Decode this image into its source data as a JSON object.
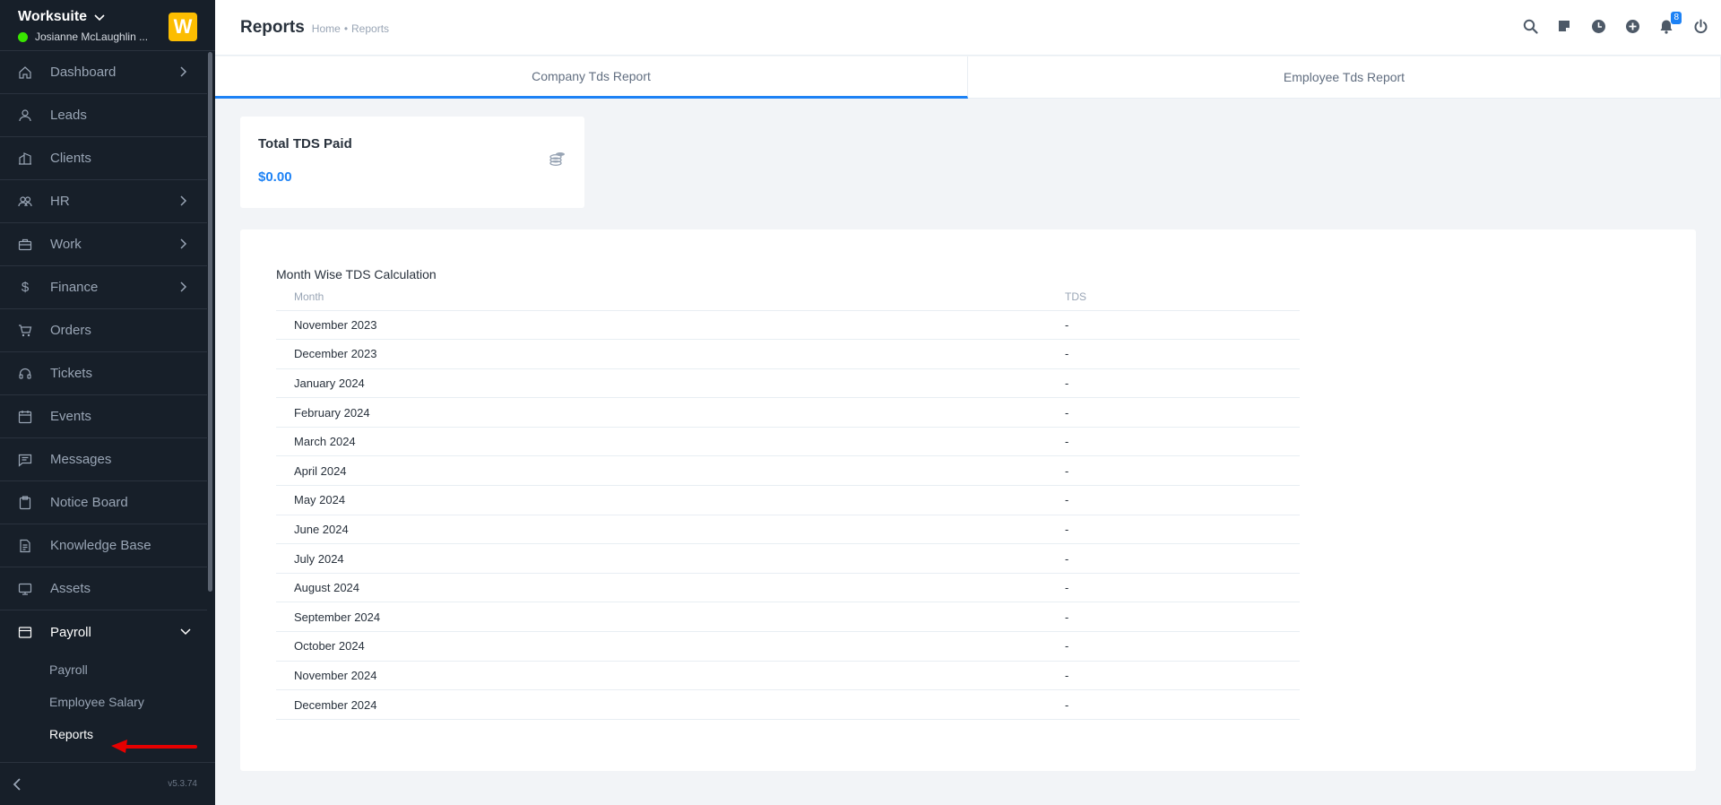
{
  "app": {
    "name": "Worksuite",
    "logo_letter": "W",
    "user_name": "Josianne McLaughlin ...",
    "version": "v5.3.74"
  },
  "sidebar": {
    "items": [
      {
        "label": "Dashboard",
        "icon": "house-icon",
        "has_chevron": true
      },
      {
        "label": "Leads",
        "icon": "person-icon",
        "has_chevron": false
      },
      {
        "label": "Clients",
        "icon": "building-icon",
        "has_chevron": false
      },
      {
        "label": "HR",
        "icon": "people-icon",
        "has_chevron": true
      },
      {
        "label": "Work",
        "icon": "briefcase-icon",
        "has_chevron": true
      },
      {
        "label": "Finance",
        "icon": "dollar-icon",
        "has_chevron": true
      },
      {
        "label": "Orders",
        "icon": "cart-icon",
        "has_chevron": false
      },
      {
        "label": "Tickets",
        "icon": "headset-icon",
        "has_chevron": false
      },
      {
        "label": "Events",
        "icon": "calendar-icon",
        "has_chevron": false
      },
      {
        "label": "Messages",
        "icon": "chat-icon",
        "has_chevron": false
      },
      {
        "label": "Notice Board",
        "icon": "clipboard-icon",
        "has_chevron": false
      },
      {
        "label": "Knowledge Base",
        "icon": "document-icon",
        "has_chevron": false
      },
      {
        "label": "Assets",
        "icon": "monitor-icon",
        "has_chevron": false
      },
      {
        "label": "Payroll",
        "icon": "wallet-icon",
        "has_chevron": true
      }
    ],
    "payroll_sub": [
      {
        "label": "Payroll"
      },
      {
        "label": "Employee Salary"
      },
      {
        "label": "Reports"
      }
    ]
  },
  "header": {
    "title": "Reports",
    "breadcrumb": [
      "Home",
      "•",
      "Reports"
    ],
    "notification_count": "8"
  },
  "tabs": [
    {
      "label": "Company Tds Report",
      "active": true
    },
    {
      "label": "Employee Tds Report",
      "active": false
    }
  ],
  "stat_card": {
    "title": "Total TDS Paid",
    "value": "$0.00"
  },
  "tds_table": {
    "title": "Month Wise TDS Calculation",
    "headers": [
      "Month",
      "TDS"
    ],
    "rows": [
      [
        "November 2023",
        "-"
      ],
      [
        "December 2023",
        "-"
      ],
      [
        "January 2024",
        "-"
      ],
      [
        "February 2024",
        "-"
      ],
      [
        "March 2024",
        "-"
      ],
      [
        "April 2024",
        "-"
      ],
      [
        "May 2024",
        "-"
      ],
      [
        "June 2024",
        "-"
      ],
      [
        "July 2024",
        "-"
      ],
      [
        "August 2024",
        "-"
      ],
      [
        "September 2024",
        "-"
      ],
      [
        "October 2024",
        "-"
      ],
      [
        "November 2024",
        "-"
      ],
      [
        "December 2024",
        "-"
      ]
    ]
  },
  "colors": {
    "sidebar_bg": "#171f29",
    "accent": "#1d82f5",
    "brand_logo": "#fcbd01",
    "online": "#39e500",
    "annotation_arrow": "#e50000"
  }
}
